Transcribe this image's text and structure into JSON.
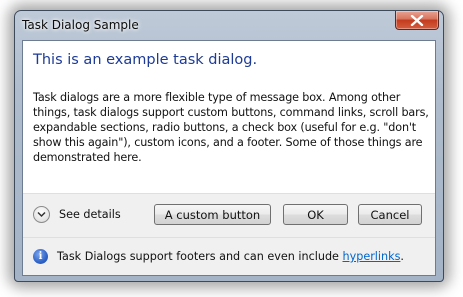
{
  "window": {
    "title": "Task Dialog Sample"
  },
  "dialog": {
    "main_instruction": "This is an example task dialog.",
    "content": "Task dialogs are a more flexible type of message box. Among other things, task dialogs support custom buttons, command links, scroll bars, expandable sections, radio buttons, a check box (useful for e.g. \"don't show this again\"), custom icons, and a footer. Some of those things are demonstrated here."
  },
  "actions": {
    "details_label": "See details",
    "custom_button": "A custom button",
    "ok_button": "OK",
    "cancel_button": "Cancel"
  },
  "footer": {
    "text": "Task Dialogs support footers and can even include ",
    "link": "hyperlinks",
    "suffix": "."
  },
  "icons": {
    "close": "close-icon",
    "expand": "chevron-down-icon",
    "info": "info-icon"
  }
}
